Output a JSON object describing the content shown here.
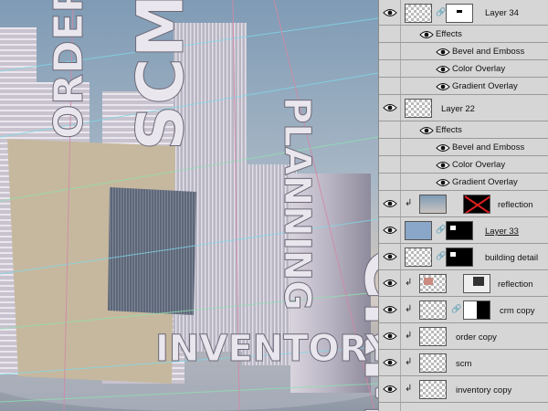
{
  "layers_panel": {
    "layers": [
      {
        "name": "Layer 34",
        "effects_label": "Effects",
        "effects": [
          "Bevel and Emboss",
          "Color Overlay",
          "Gradient Overlay"
        ]
      },
      {
        "name": "Layer 22",
        "effects_label": "Effects",
        "effects": [
          "Bevel and Emboss",
          "Color Overlay",
          "Gradient Overlay"
        ]
      },
      {
        "name": "reflection"
      },
      {
        "name": "Layer 33"
      },
      {
        "name": "building detail"
      },
      {
        "name": "reflection"
      },
      {
        "name": "crm copy"
      },
      {
        "name": "order copy"
      },
      {
        "name": "scm"
      },
      {
        "name": "inventory copy"
      }
    ]
  },
  "canvas": {
    "building_words": [
      "ORDER",
      "SCM",
      "PLANNING",
      "CRM",
      "INVENTORY"
    ],
    "colors": {
      "sky_top": "#7f9bb5",
      "sky_bottom": "#c9c4c0",
      "panel_bg": "#d6d6d6",
      "selection_guide": "#d08aa6"
    }
  }
}
